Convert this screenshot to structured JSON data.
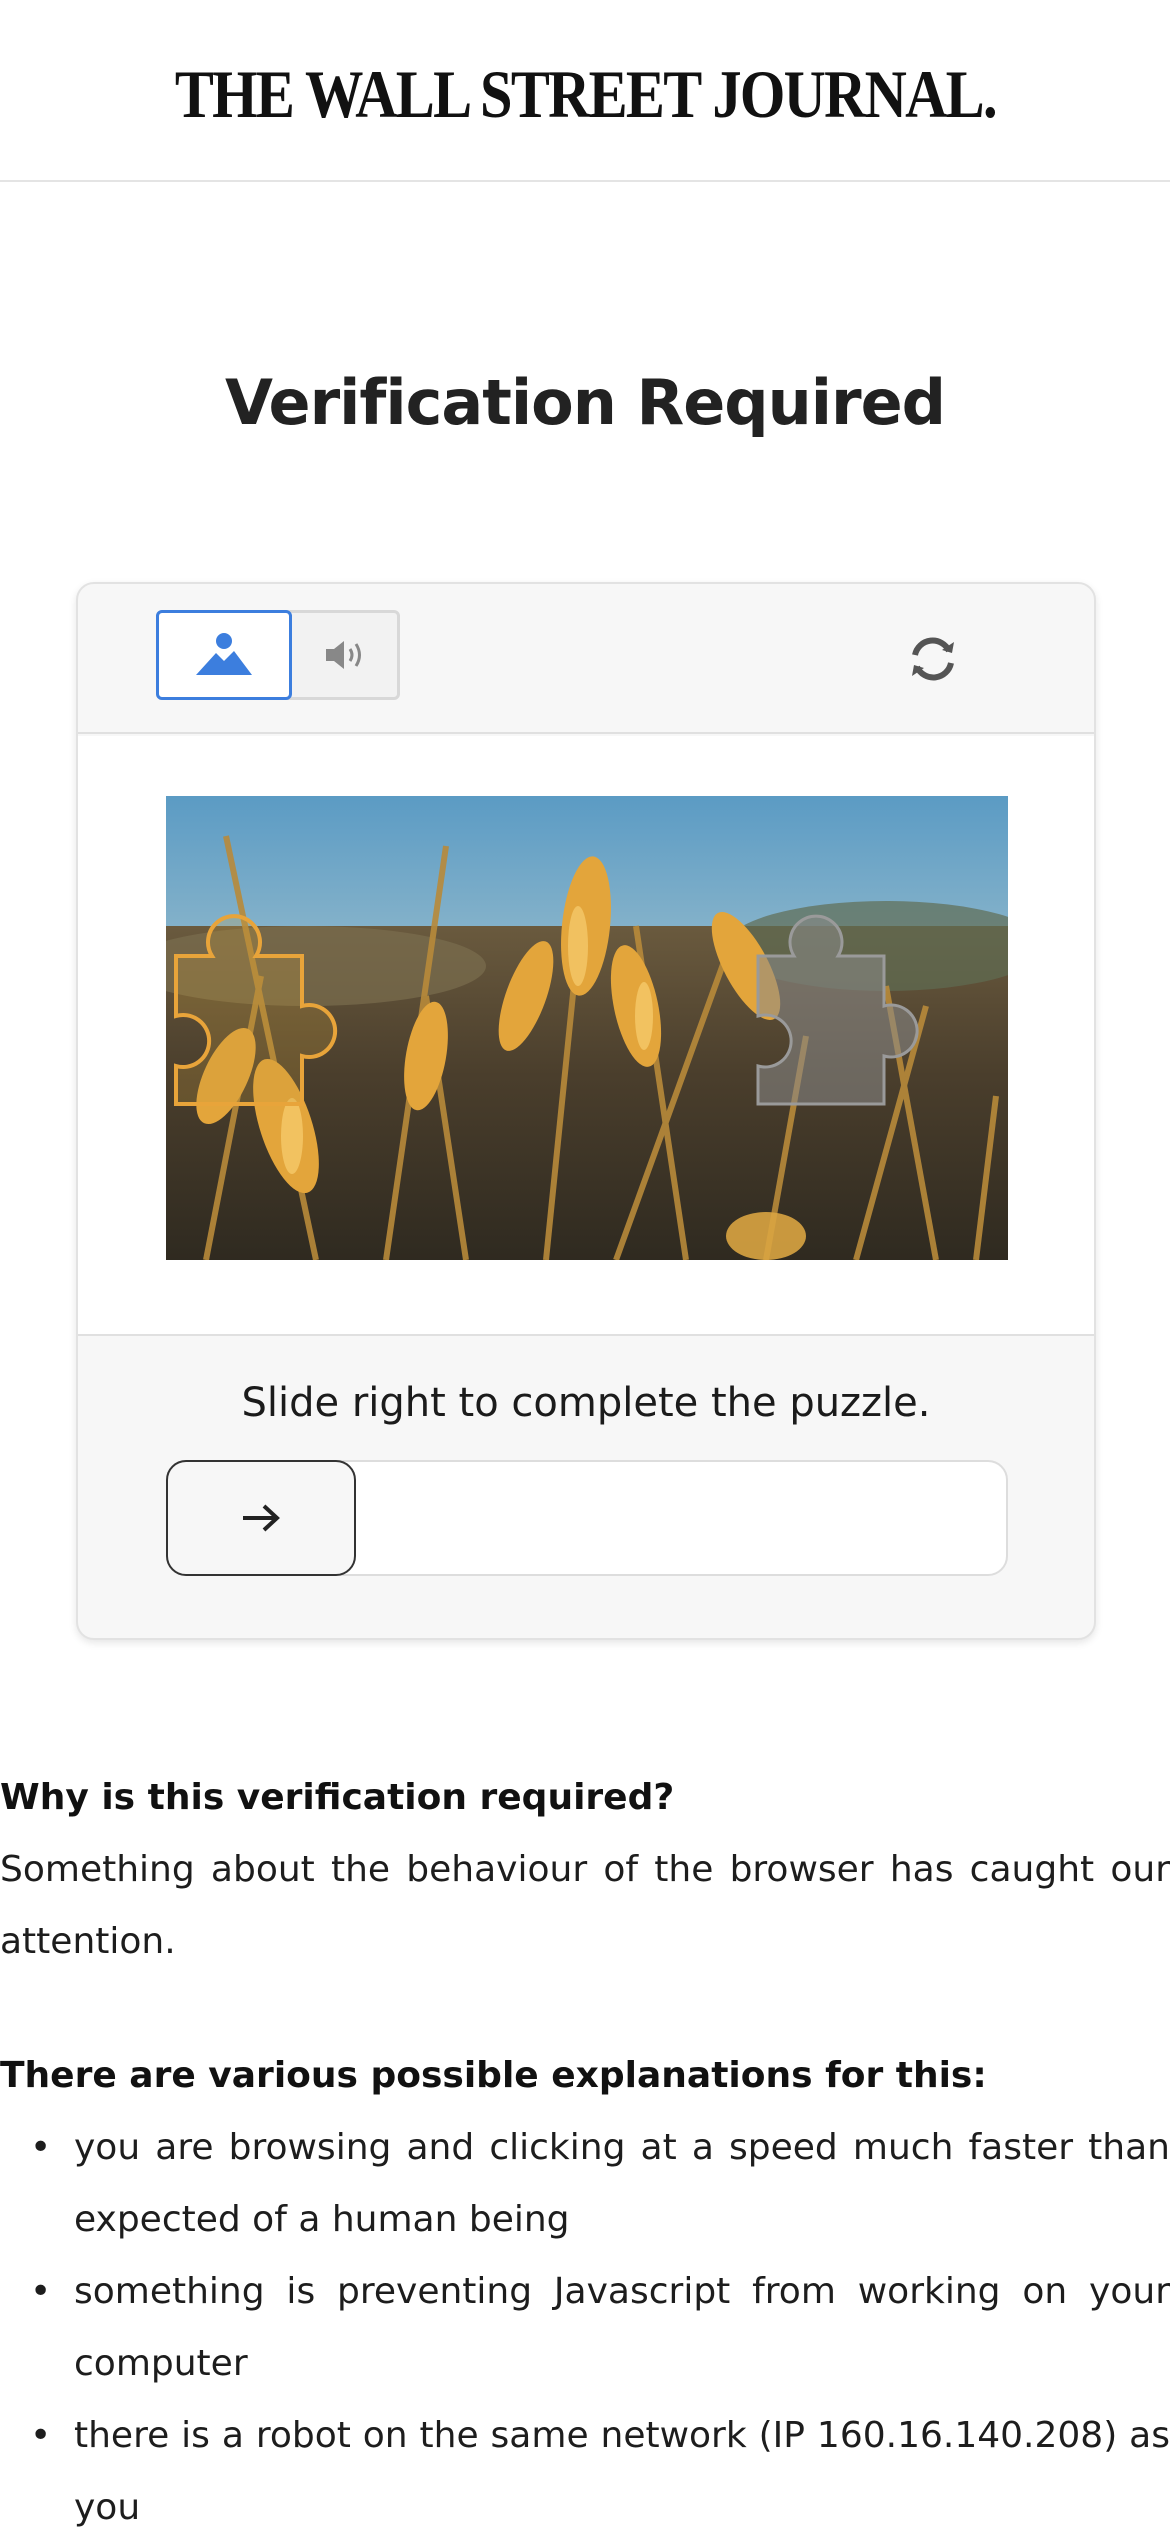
{
  "masthead": {
    "logo_text": "THE WALL STREET JOURNAL."
  },
  "page": {
    "title": "Verification Required"
  },
  "captcha": {
    "mode_visual_icon": "image-icon",
    "mode_audio_icon": "speaker-icon",
    "refresh_icon": "refresh-icon",
    "instruction": "Slide right to complete the puzzle.",
    "slider_icon": "arrow-right-icon",
    "slider_progress": 0,
    "accent_color": "#3c7ede"
  },
  "info": {
    "question_heading": "Why is this verification required?",
    "question_text": "Something about the behaviour of the browser has caught our attention.",
    "explanations_heading": "There are various possible explanations for this:",
    "explanations": [
      "you are browsing and clicking at a speed much faster than expected of a human being",
      "something is preventing Javascript from working on your computer",
      "there is a robot on the same network (IP 160.16.140.208) as you"
    ]
  }
}
